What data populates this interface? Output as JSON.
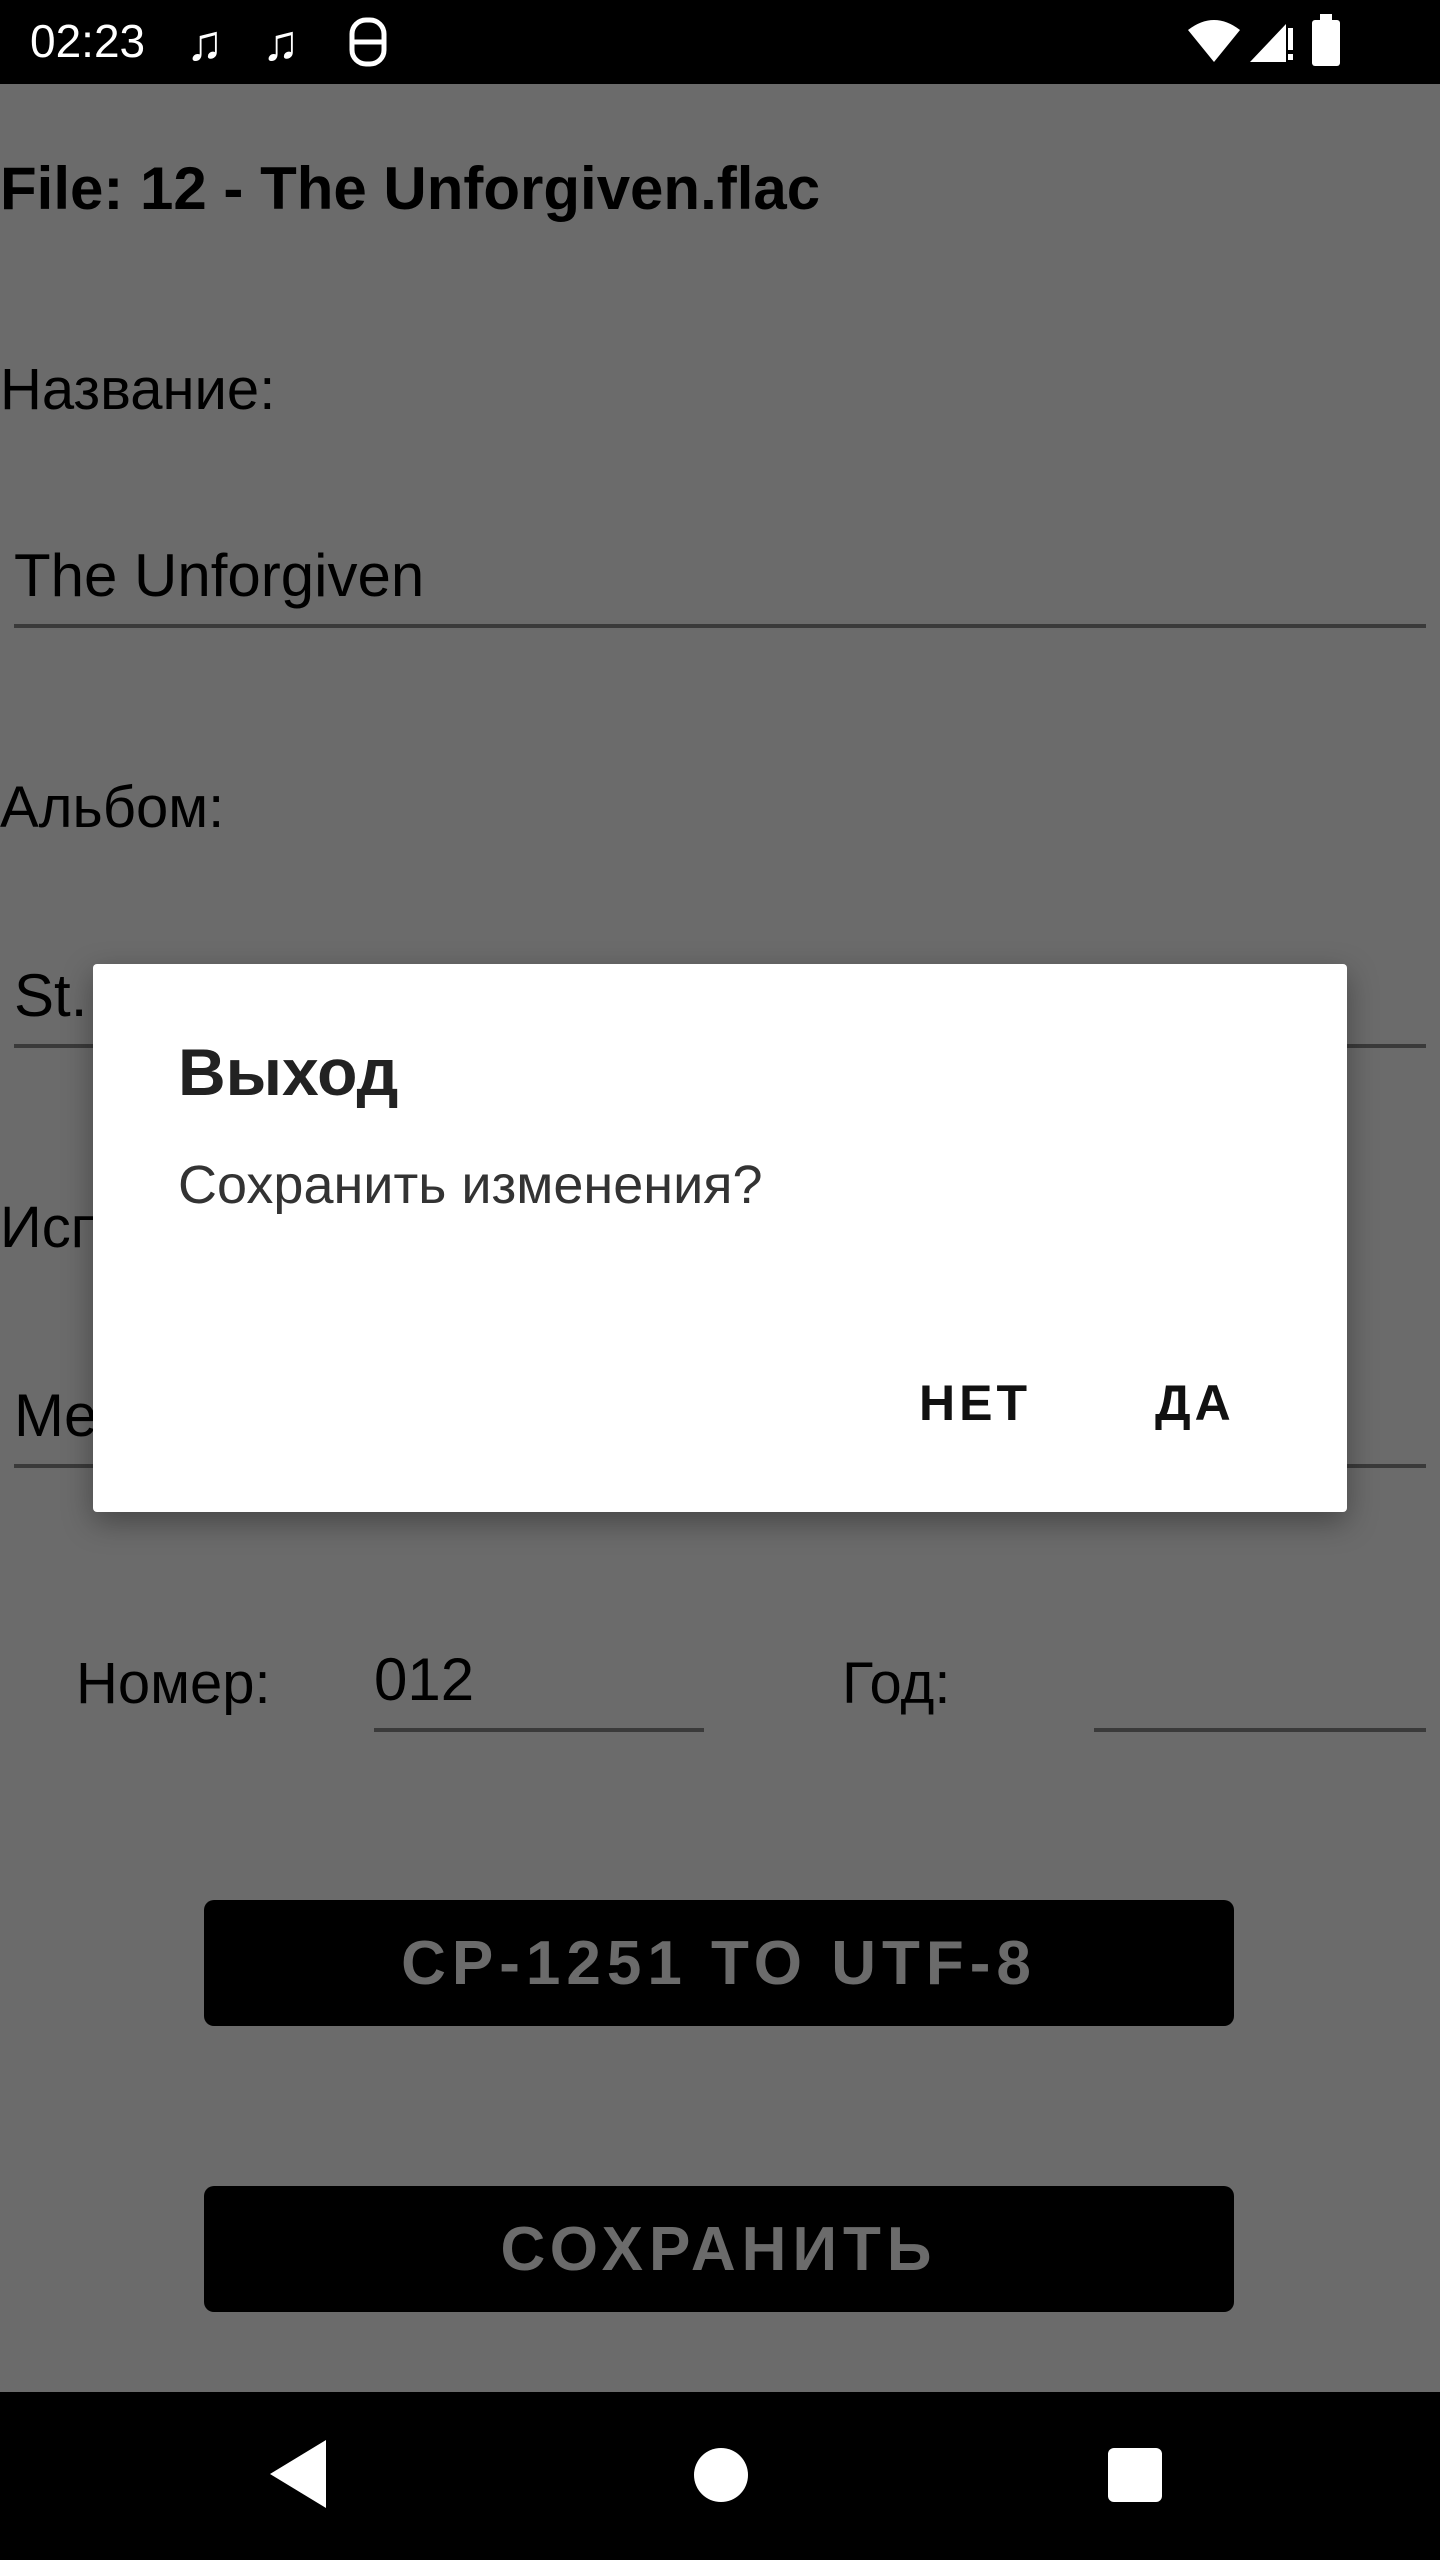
{
  "status_bar": {
    "time": "02:23",
    "notification_icons": [
      "music-note-icon",
      "music-note-icon",
      "sim-icon"
    ],
    "system_icons": [
      "wifi-icon",
      "signal-icon",
      "battery-icon"
    ]
  },
  "screen": {
    "file_title": "File: 12 - The Unforgiven.flac",
    "title_label": "Название:",
    "title_value": "The Unforgiven",
    "album_label": "Альбом:",
    "album_value": "St.",
    "artist_label": "Исп",
    "artist_value": "Me",
    "number_label": "Номер:",
    "number_value": "012",
    "year_label": "Год:",
    "year_value": "",
    "convert_button": "CP-1251 TO UTF-8",
    "save_button": "СОХРАНИТЬ"
  },
  "dialog": {
    "title": "Выход",
    "message": "Сохранить изменения?",
    "negative": "НЕТ",
    "positive": "ДА"
  },
  "colors": {
    "scrim": "#6b6b6b",
    "dialog_bg": "#ffffff",
    "bar_bg": "#000000"
  }
}
